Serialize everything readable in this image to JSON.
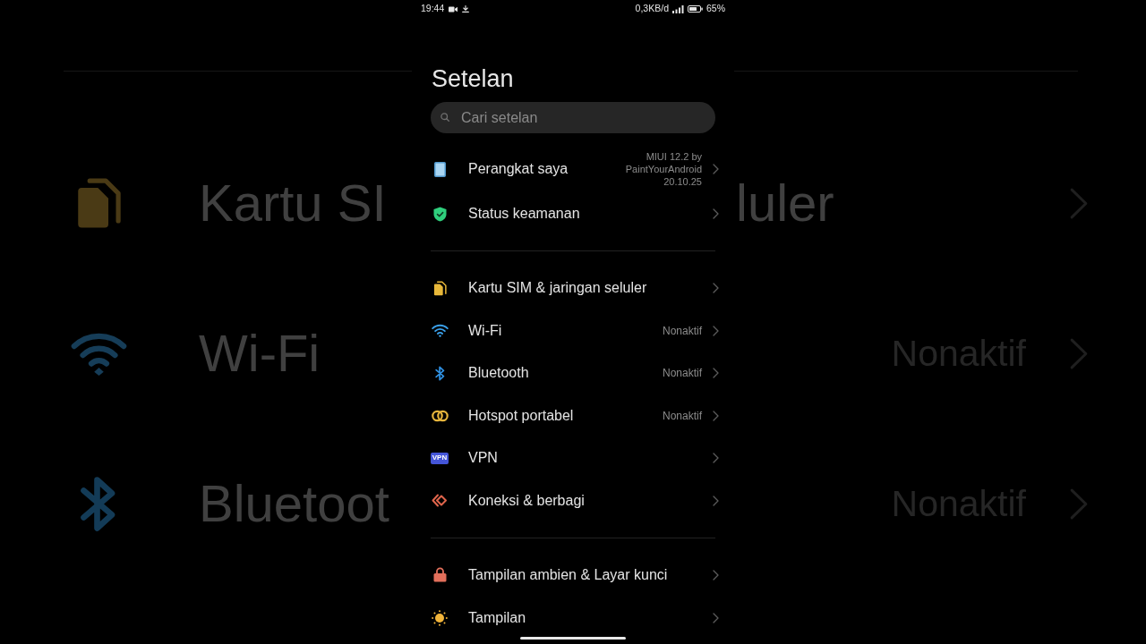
{
  "backdrop": {
    "rows": [
      {
        "left_text": "Kartu SI",
        "right_text": "luler"
      },
      {
        "left_text": "Wi-Fi",
        "value": "Nonaktif"
      },
      {
        "left_text": "Bluetoot",
        "value": "Nonaktif"
      }
    ]
  },
  "status_bar": {
    "time": "19:44",
    "net_speed": "0,3KB/d",
    "battery": "65%"
  },
  "title": "Setelan",
  "search": {
    "placeholder": "Cari setelan"
  },
  "sections": [
    {
      "items": [
        {
          "label": "Perangkat saya",
          "value": "MIUI 12.2 by PaintYourAndroid 20.10.25"
        },
        {
          "label": "Status keamanan"
        }
      ]
    },
    {
      "items": [
        {
          "label": "Kartu SIM & jaringan seluler"
        },
        {
          "label": "Wi-Fi",
          "value": "Nonaktif"
        },
        {
          "label": "Bluetooth",
          "value": "Nonaktif"
        },
        {
          "label": "Hotspot portabel",
          "value": "Nonaktif"
        },
        {
          "label": "VPN",
          "icon_text": "VPN"
        },
        {
          "label": "Koneksi & berbagi"
        }
      ]
    },
    {
      "items": [
        {
          "label": "Tampilan ambien & Layar kunci"
        },
        {
          "label": "Tampilan"
        }
      ]
    }
  ]
}
